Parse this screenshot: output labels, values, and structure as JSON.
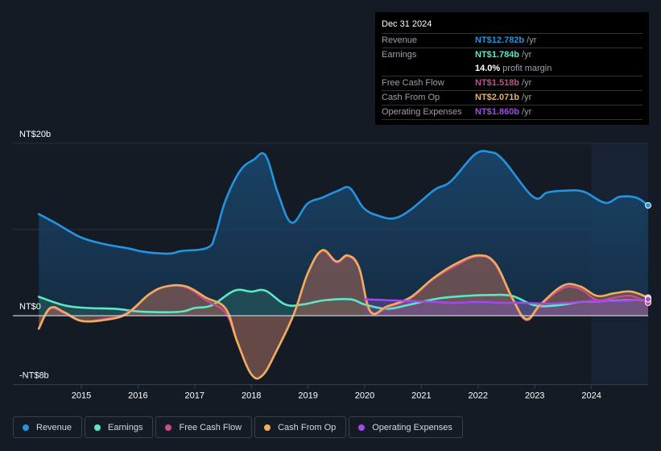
{
  "tooltip": {
    "date": "Dec 31 2024",
    "rows": [
      {
        "label": "Revenue",
        "value": "NT$12.782b",
        "unit": "/yr",
        "color": "#2394df"
      },
      {
        "label": "Earnings",
        "value": "NT$1.784b",
        "unit": "/yr",
        "color": "#5ee6c8"
      },
      {
        "label": "",
        "value": "14.0%",
        "unit": "profit margin",
        "color": "#ffffff"
      },
      {
        "label": "Free Cash Flow",
        "value": "NT$1.518b",
        "unit": "/yr",
        "color": "#c94c8a"
      },
      {
        "label": "Cash From Op",
        "value": "NT$2.071b",
        "unit": "/yr",
        "color": "#f0ad5a"
      },
      {
        "label": "Operating Expenses",
        "value": "NT$1.860b",
        "unit": "/yr",
        "color": "#a347f0"
      }
    ]
  },
  "legend": [
    {
      "label": "Revenue",
      "color": "#2394df"
    },
    {
      "label": "Earnings",
      "color": "#5ee6c8"
    },
    {
      "label": "Free Cash Flow",
      "color": "#c94c8a"
    },
    {
      "label": "Cash From Op",
      "color": "#f0ad5a"
    },
    {
      "label": "Operating Expenses",
      "color": "#a347f0"
    }
  ],
  "chart_data": {
    "type": "area",
    "title": "",
    "xlabel": "",
    "ylabel": "",
    "currency": "NT$",
    "unit": "b",
    "ylim": [
      -8,
      20
    ],
    "xlim": [
      2014.25,
      2025.0
    ],
    "y_ticks": [
      {
        "value": 20,
        "label": "NT$20b"
      },
      {
        "value": 0,
        "label": "NT$0"
      },
      {
        "value": -8,
        "label": "-NT$8b"
      }
    ],
    "x_ticks": [
      2015,
      2016,
      2017,
      2018,
      2019,
      2020,
      2021,
      2022,
      2023,
      2024
    ],
    "highlight_range": [
      2024.0,
      2025.0
    ],
    "grid": true,
    "legend_position": "bottom-left",
    "series": [
      {
        "name": "Revenue",
        "color": "#2394df",
        "x": [
          2014.25,
          2014.56,
          2014.99,
          2015.41,
          2015.84,
          2016.12,
          2016.55,
          2016.76,
          2017.23,
          2017.37,
          2017.54,
          2017.8,
          2018.04,
          2018.25,
          2018.47,
          2018.71,
          2018.99,
          2019.25,
          2019.53,
          2019.74,
          2019.98,
          2020.24,
          2020.52,
          2020.81,
          2021.23,
          2021.52,
          2021.94,
          2022.2,
          2022.44,
          2022.97,
          2023.22,
          2023.51,
          2023.86,
          2024.24,
          2024.5,
          2024.79,
          2025.0
        ],
        "values": [
          11.8,
          10.7,
          9.1,
          8.3,
          7.8,
          7.4,
          7.2,
          7.5,
          7.9,
          9.5,
          13.3,
          16.8,
          18.1,
          18.6,
          14.2,
          10.8,
          13.0,
          13.7,
          14.5,
          14.8,
          12.5,
          11.6,
          11.3,
          12.3,
          14.6,
          15.6,
          18.7,
          19.0,
          18.1,
          13.8,
          14.3,
          14.5,
          14.4,
          13.1,
          13.8,
          13.7,
          12.8
        ]
      },
      {
        "name": "Earnings",
        "color": "#5ee6c8",
        "x": [
          2014.25,
          2014.7,
          2015.1,
          2015.6,
          2016.0,
          2016.5,
          2016.8,
          2017.0,
          2017.3,
          2017.7,
          2018.0,
          2018.25,
          2018.6,
          2018.9,
          2019.3,
          2019.75,
          2020.0,
          2020.4,
          2020.8,
          2021.3,
          2021.8,
          2022.2,
          2022.6,
          2023.0,
          2023.4,
          2023.8,
          2024.2,
          2024.6,
          2025.0
        ],
        "values": [
          2.2,
          1.2,
          0.9,
          0.8,
          0.5,
          0.4,
          0.5,
          0.9,
          1.2,
          2.9,
          2.8,
          2.9,
          1.3,
          1.3,
          1.8,
          1.9,
          1.3,
          0.8,
          1.3,
          2.0,
          2.3,
          2.4,
          2.3,
          1.2,
          1.2,
          1.6,
          1.7,
          1.8,
          1.8
        ]
      },
      {
        "name": "Free Cash Flow",
        "color": "#c94c8a",
        "x": [
          2014.25,
          2014.45,
          2014.7,
          2015.0,
          2015.4,
          2015.8,
          2016.2,
          2016.5,
          2016.85,
          2017.2,
          2017.55,
          2017.75,
          2018.0,
          2018.2,
          2018.45,
          2018.75,
          2019.0,
          2019.25,
          2019.5,
          2019.7,
          2019.9,
          2020.1,
          2020.4,
          2020.8,
          2021.2,
          2021.6,
          2022.0,
          2022.3,
          2022.6,
          2022.85,
          2023.1,
          2023.5,
          2023.8,
          2024.1,
          2024.4,
          2024.7,
          2025.0
        ],
        "values": [
          -1.5,
          0.8,
          0.3,
          -0.6,
          -0.4,
          0.3,
          2.5,
          3.4,
          3.3,
          1.8,
          0.3,
          -3.0,
          -6.8,
          -6.9,
          -4.0,
          0.2,
          5.0,
          7.5,
          6.2,
          6.9,
          5.5,
          0.4,
          1.0,
          2.0,
          4.2,
          5.8,
          6.9,
          6.0,
          2.0,
          -0.5,
          1.2,
          3.2,
          3.1,
          1.8,
          2.1,
          2.3,
          1.5
        ]
      },
      {
        "name": "Cash From Op",
        "color": "#f0ad5a",
        "x": [
          2014.25,
          2014.45,
          2014.7,
          2015.0,
          2015.4,
          2015.8,
          2016.2,
          2016.5,
          2016.85,
          2017.2,
          2017.55,
          2017.75,
          2018.0,
          2018.2,
          2018.45,
          2018.75,
          2019.0,
          2019.25,
          2019.5,
          2019.7,
          2019.9,
          2020.1,
          2020.4,
          2020.8,
          2021.2,
          2021.6,
          2022.0,
          2022.3,
          2022.6,
          2022.85,
          2023.1,
          2023.5,
          2023.8,
          2024.1,
          2024.4,
          2024.7,
          2025.0
        ],
        "values": [
          -1.5,
          0.9,
          0.4,
          -0.6,
          -0.5,
          0.2,
          2.5,
          3.4,
          3.4,
          2.1,
          0.8,
          -3.0,
          -6.8,
          -6.9,
          -4.0,
          0.2,
          5.0,
          7.6,
          6.3,
          7.0,
          5.6,
          0.5,
          1.1,
          2.1,
          4.3,
          6.0,
          7.0,
          6.1,
          2.1,
          -0.4,
          1.3,
          3.5,
          3.4,
          2.3,
          2.6,
          2.8,
          2.1
        ]
      },
      {
        "name": "Operating Expenses",
        "color": "#a347f0",
        "x": [
          2020.0,
          2020.4,
          2020.8,
          2021.2,
          2021.6,
          2022.0,
          2022.4,
          2022.8,
          2023.2,
          2023.6,
          2024.0,
          2024.4,
          2024.8,
          2025.0
        ],
        "values": [
          1.9,
          1.8,
          1.7,
          1.6,
          1.5,
          1.6,
          1.5,
          1.5,
          1.4,
          1.5,
          1.7,
          1.7,
          1.8,
          1.9
        ]
      }
    ]
  }
}
